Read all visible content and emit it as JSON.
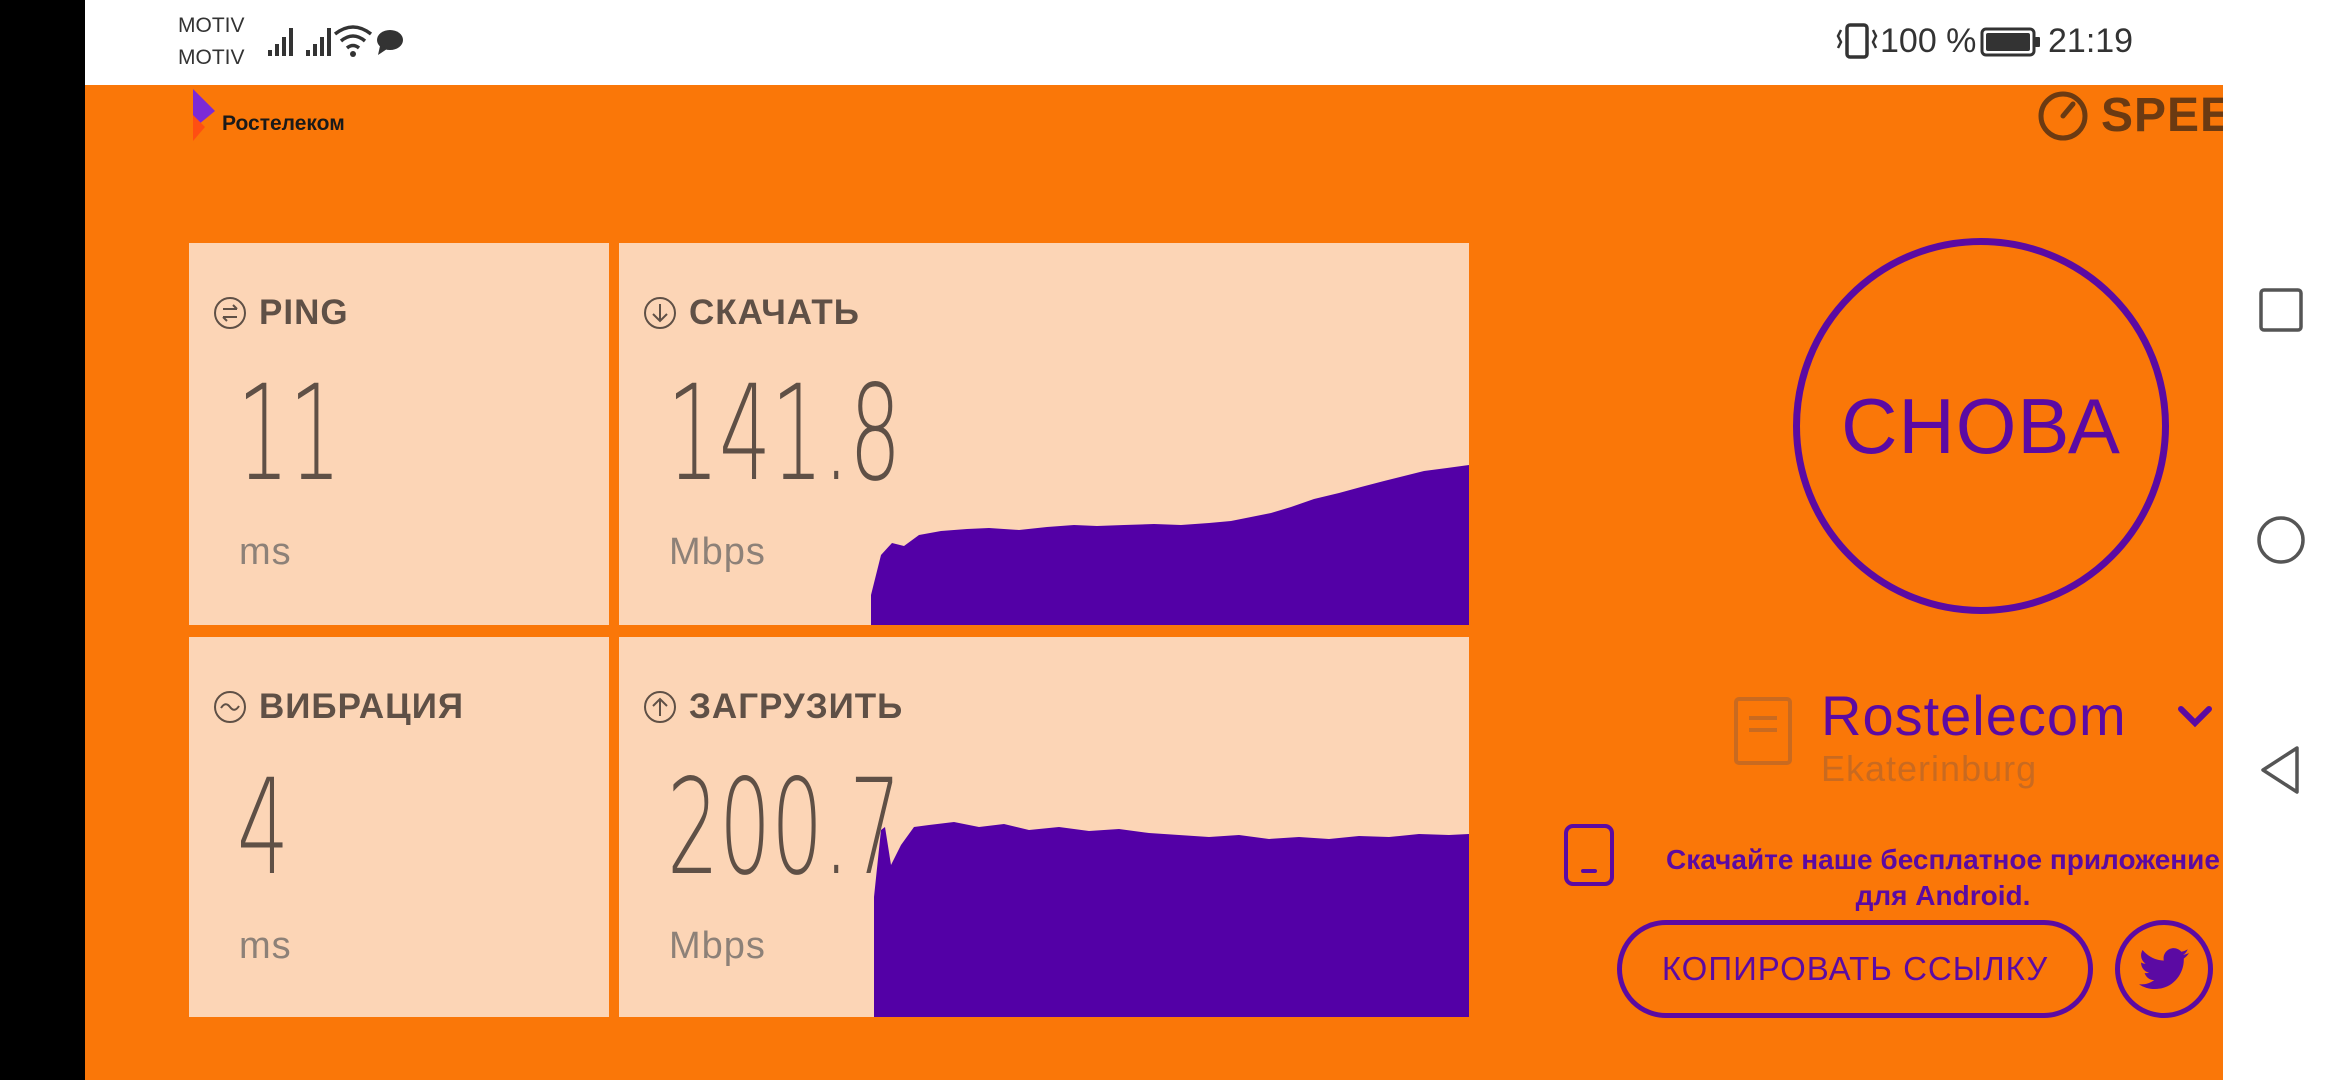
{
  "status_bar": {
    "carrier_1": "MOTIV",
    "carrier_2": "MOTIV",
    "battery_text": "100 %",
    "time": "21:19"
  },
  "header": {
    "brand_name": "Ростелеком",
    "speedtest_logo_text": "SPEE"
  },
  "tiles": {
    "ping": {
      "label": "PING",
      "value": "11",
      "unit": "ms"
    },
    "download": {
      "label": "СКАЧАТЬ",
      "value": "141.8",
      "unit": "Mbps"
    },
    "jitter": {
      "label": "ВИБРАЦИЯ",
      "value": "4",
      "unit": "ms"
    },
    "upload": {
      "label": "ЗАГРУЗИТЬ",
      "value": "200.7",
      "unit": "Mbps"
    }
  },
  "go_button": {
    "label": "СНОВА"
  },
  "server": {
    "name": "Rostelecom",
    "city": "Ekaterinburg"
  },
  "promo": {
    "line_1": "Скачайте наше бесплатное приложение",
    "line_2": "для Android."
  },
  "share": {
    "copy_link_label": "КОПИРОВАТЬ ССЫЛКУ",
    "twitter_icon": "twitter-bird-icon"
  },
  "nav_bar": {
    "icons": [
      "recents-square-icon",
      "home-circle-icon",
      "back-triangle-icon"
    ]
  },
  "colors": {
    "background": "#fa7708",
    "tile": "#fcd5b6",
    "accent": "#5b0aa3",
    "text_dark": "#5f5046"
  }
}
